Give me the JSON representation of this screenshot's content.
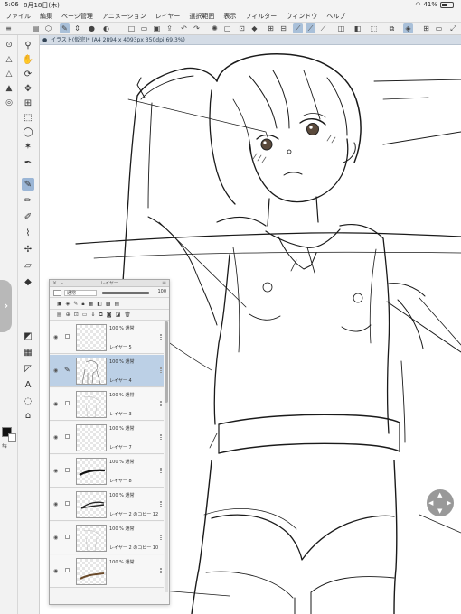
{
  "status": {
    "time": "5:06",
    "date": "8月18日(木)",
    "battery": "41%",
    "battery_level": 0.41
  },
  "menu": [
    "ファイル",
    "編集",
    "ページ管理",
    "アニメーション",
    "レイヤー",
    "選択範囲",
    "表示",
    "フィルター",
    "ウィンドウ",
    "ヘルプ"
  ],
  "document": {
    "tab_title": "イラスト(仮完)* (A4 2894 x 4093px 350dpi 69.3%)"
  },
  "layer_panel": {
    "title": "レイヤー",
    "blend_mode": "通常",
    "opacity": "100",
    "opacity_level": 1.0,
    "layers": [
      {
        "mode": "100 % 通常",
        "name": "レイヤー 5",
        "selected": false,
        "thumb": "empty"
      },
      {
        "mode": "100 % 通常",
        "name": "レイヤー 4",
        "selected": true,
        "thumb": "sketch"
      },
      {
        "mode": "100 % 通常",
        "name": "レイヤー 3",
        "selected": false,
        "thumb": "faint"
      },
      {
        "mode": "100 % 通常",
        "name": "レイヤー 7",
        "selected": false,
        "thumb": "empty"
      },
      {
        "mode": "100 % 通常",
        "name": "レイヤー 8",
        "selected": false,
        "thumb": "stroke"
      },
      {
        "mode": "100 % 通常",
        "name": "レイヤー 2 のコピー 12",
        "selected": false,
        "thumb": "stroke2"
      },
      {
        "mode": "100 % 通常",
        "name": "レイヤー 2 のコピー 10",
        "selected": false,
        "thumb": "faint"
      },
      {
        "mode": "100 % 通常",
        "name": "",
        "selected": false,
        "thumb": "stroke3"
      }
    ]
  },
  "colors": {
    "main": "#111111",
    "sub": "#ffffff",
    "accent": "#9bb6d6",
    "selection": "#bcd0e6"
  },
  "icons": {
    "toolbar": [
      "menu-icon",
      "layer-property-icon",
      "cube-icon",
      "active-tool-icon",
      "stabilizer-icon",
      "new-canvas-icon",
      "open-icon",
      "save-icon",
      "export-icon",
      "undo-icon",
      "redo-icon",
      "rotate-icon",
      "clear-icon",
      "transform-icon",
      "fill-icon",
      "ruler-icon",
      "snap-icon",
      "snap-ruler-icon",
      "snap-grid-icon",
      "perspective-icon",
      "guide-icon",
      "hide-icon",
      "select-icon",
      "layer-panel-icon",
      "settings-icon"
    ],
    "tools": [
      "zoom-icon",
      "hand-icon",
      "rotate-view-icon",
      "move-icon",
      "transform-tool-icon",
      "selection-icon",
      "lasso-icon",
      "magic-wand-icon",
      "eyedropper-icon",
      "pen-icon",
      "pencil-icon",
      "brush-icon",
      "airbrush-icon",
      "decoration-icon",
      "eraser-icon",
      "blend-icon",
      "fill-tool-icon",
      "gradient-icon",
      "shape-icon",
      "frame-icon",
      "ruler-tool-icon",
      "text-icon",
      "balloon-icon",
      "correct-line-icon"
    ]
  }
}
